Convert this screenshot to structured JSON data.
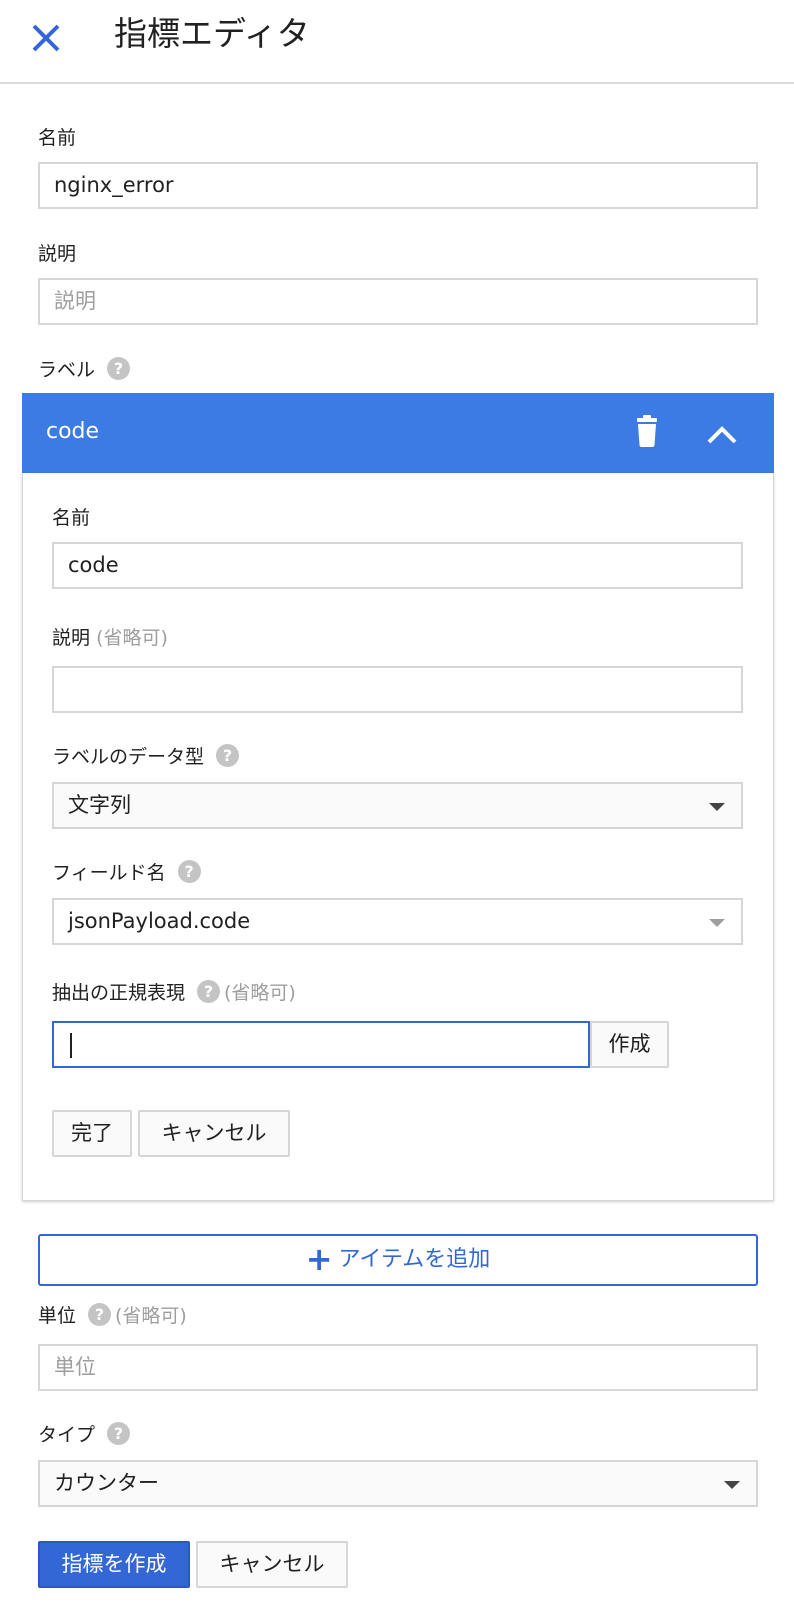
{
  "header": {
    "title": "指標エディタ",
    "close_icon": "close-icon"
  },
  "form": {
    "name_label": "名前",
    "name_value": "nginx_error",
    "description_label": "説明",
    "description_placeholder": "説明",
    "labels_label": "ラベル"
  },
  "label_panel": {
    "title": "code",
    "name_label": "名前",
    "name_value": "code",
    "description_label": "説明",
    "description_optional": "(省略可)",
    "description_value": "",
    "data_type_label": "ラベルのデータ型",
    "data_type_value": "文字列",
    "field_name_label": "フィールド名",
    "field_name_value": "jsonPayload.code",
    "regex_label": "抽出の正規表現",
    "regex_optional": "(省略可)",
    "regex_value": "",
    "build_button": "作成",
    "done_button": "完了",
    "cancel_button": "キャンセル"
  },
  "add_item_button": "アイテムを追加",
  "units": {
    "label": "単位",
    "optional": "(省略可)",
    "placeholder": "単位"
  },
  "type": {
    "label": "タイプ",
    "value": "カウンター"
  },
  "footer": {
    "create_button": "指標を作成",
    "cancel_button": "キャンセル"
  },
  "colors": {
    "accent": "#3367d6",
    "panel_header": "#3c7be3"
  }
}
